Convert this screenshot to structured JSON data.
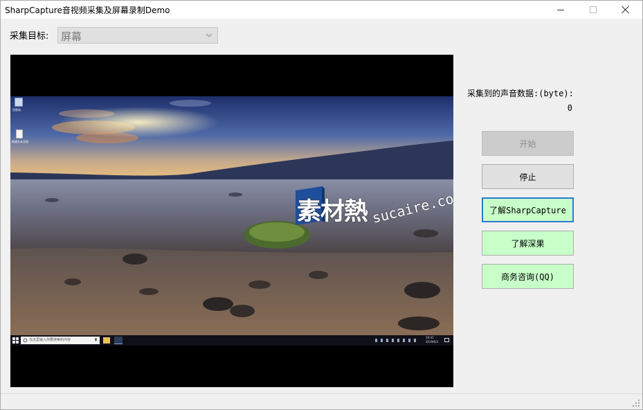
{
  "window": {
    "title": "SharpCapture音视频采集及屏幕录制Demo"
  },
  "capture_target": {
    "label": "采集目标:",
    "selected": "屏幕"
  },
  "preview": {
    "taskbar_search_placeholder": "在这里输入你要搜索的内容",
    "clock_time": "19:41",
    "clock_date": "2019/6/3",
    "desktop_icons": [
      "回收站",
      "新建文本文档"
    ],
    "watermark_cn": "素材熱",
    "watermark_url": "sucaire.com"
  },
  "audio": {
    "label": "采集到的声音数据:(byte):",
    "value": "0"
  },
  "buttons": {
    "start": "开始",
    "stop": "停止",
    "learn_sharpcapture": "了解SharpCapture",
    "learn_shenguo": "了解深果",
    "business_qq": "商务咨询(QQ)"
  },
  "colors": {
    "green_button": "#c8ffc8",
    "focus_border": "#2b79d6",
    "disabled_button": "#cccccc"
  }
}
